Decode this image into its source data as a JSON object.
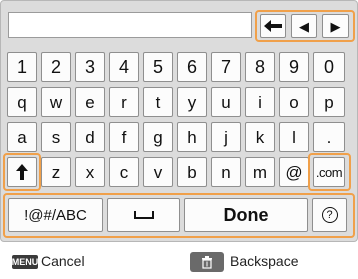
{
  "nav": {
    "left_arrow_glyph": "◀",
    "right_arrow_glyph": "▶"
  },
  "keyboard": {
    "row1": [
      "1",
      "2",
      "3",
      "4",
      "5",
      "6",
      "7",
      "8",
      "9",
      "0"
    ],
    "row2": [
      "q",
      "w",
      "e",
      "r",
      "t",
      "y",
      "u",
      "i",
      "o",
      "p"
    ],
    "row3": [
      "a",
      "s",
      "d",
      "f",
      "g",
      "h",
      "j",
      "k",
      "l",
      "."
    ],
    "row4": [
      "z",
      "x",
      "c",
      "v",
      "b",
      "n",
      "m",
      "@"
    ],
    "com_label": ".com",
    "symbols_label": "!@#/ABC",
    "done_label": "Done",
    "help_label": "?"
  },
  "footer": {
    "menu_badge": "MENU",
    "cancel_label": "Cancel",
    "backspace_label": "Backspace"
  },
  "colors": {
    "highlight": "#f0a04a",
    "panel": "#dcdcdc",
    "key": "#fcfcfc"
  }
}
